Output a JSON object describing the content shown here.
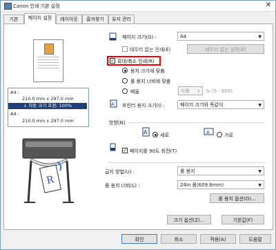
{
  "window": {
    "title": "Canon 인쇄 기본 설정",
    "close": "✕"
  },
  "tabs": [
    "기본",
    "페이지 설정",
    "레이아웃",
    "즐겨찾기",
    "유지 관리"
  ],
  "preview": {
    "info_line1": "A4 :",
    "info_line2": "210.0 mm x 297.0 mm",
    "info_bar": "↓ 자동 크기 조정: 100%",
    "info_line3": "A4 :",
    "info_line4": "210.0 mm x 297.0 mm"
  },
  "page_size": {
    "label": "페이지 크기(G) :",
    "value": "A4"
  },
  "borderless": {
    "label": "테두리 없는 인쇄(E)",
    "button": "테두리 없는 설정(B)"
  },
  "scaling": {
    "label": "확대/축소 인쇄(R)",
    "fit_page": "용지 크기에 맞춤",
    "fit_roll": "롤 용지 너비에 맞춤",
    "scale": "배율",
    "scale_value": "자동",
    "scale_range": "% (5 - 600)"
  },
  "printer_paper": {
    "label": "프린터 용지 크기(I) :",
    "value": "페이지 크기와 똑같이"
  },
  "orientation": {
    "label": "방향(N)",
    "portrait": "세로",
    "landscape": "가로"
  },
  "rotate": {
    "label": "페이지를 90도 회전(T)"
  },
  "paper_source": {
    "label": "급지 방법(U) :",
    "value": "롤 용지"
  },
  "roll_width": {
    "label": "롤 용지 너비(L) :",
    "value": "24in 롤(609.6mm)"
  },
  "roll_options_button": "롤 용지 옵션(O)...",
  "size_options_button": "크기 옵션(Z)...",
  "defaults_button": "기본값(F)",
  "footer": {
    "ok": "확인",
    "cancel": "취소",
    "apply": "적용(A)",
    "help": "도움말"
  }
}
